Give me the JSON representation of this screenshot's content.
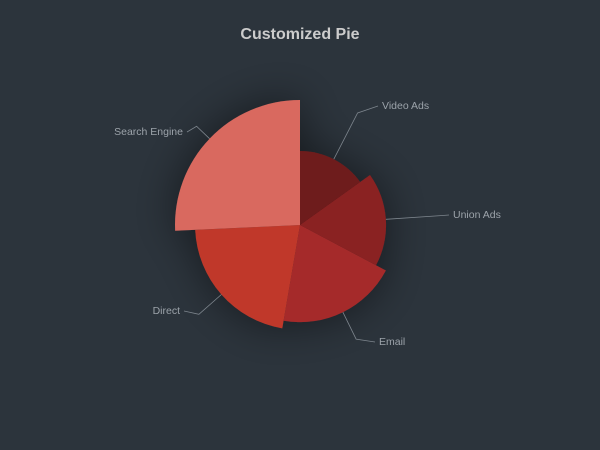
{
  "chart_data": {
    "type": "pie",
    "style": "nightingale-radius",
    "title": "Customized Pie",
    "background_color": "#2c343c",
    "legend": "none",
    "slices": [
      {
        "name": "Video Ads",
        "value": 235,
        "color": "#6e1b1b"
      },
      {
        "name": "Union Ads",
        "value": 274,
        "color": "#8a2020"
      },
      {
        "name": "Email",
        "value": 310,
        "color": "#a52a2a"
      },
      {
        "name": "Direct",
        "value": 335,
        "color": "#c0392b"
      },
      {
        "name": "Search Engine",
        "value": 400,
        "color": "#d9695f"
      }
    ]
  }
}
